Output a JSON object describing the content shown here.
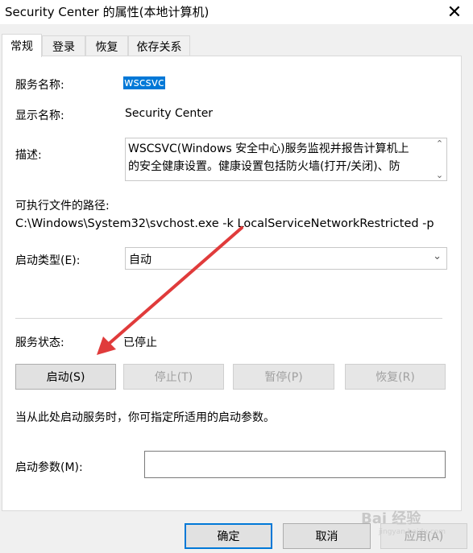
{
  "window": {
    "title": "Security Center 的属性(本地计算机)",
    "close_glyph": "✕"
  },
  "tabs": [
    {
      "label": "常规",
      "active": true
    },
    {
      "label": "登录",
      "active": false
    },
    {
      "label": "恢复",
      "active": false
    },
    {
      "label": "依存关系",
      "active": false
    }
  ],
  "general": {
    "service_name_label": "服务名称:",
    "service_name_value": "wscsvc",
    "display_name_label": "显示名称:",
    "display_name_value": "Security Center",
    "description_label": "描述:",
    "description_line1": "WSCSVC(Windows 安全中心)服务监视并报告计算机上",
    "description_line2": "的安全健康设置。健康设置包括防火墙(打开/关闭)、防",
    "exe_path_label": "可执行文件的路径:",
    "exe_path_value": "C:\\Windows\\System32\\svchost.exe -k LocalServiceNetworkRestricted -p",
    "startup_type_label": "启动类型(E):",
    "startup_type_value": "自动",
    "service_status_label": "服务状态:",
    "service_status_value": "已停止",
    "start_button": "启动(S)",
    "stop_button": "停止(T)",
    "pause_button": "暂停(P)",
    "resume_button": "恢复(R)",
    "hint_text": "当从此处启动服务时，你可指定所适用的启动参数。",
    "start_params_label": "启动参数(M):",
    "start_params_value": ""
  },
  "footer": {
    "ok_button": "确定",
    "cancel_button": "取消",
    "apply_button": "应用(A)"
  },
  "watermark": {
    "brand": "Bai 经验",
    "url": "jingyan.baidu.com"
  },
  "colors": {
    "accent": "#0078d7",
    "annotation_arrow": "#e03b3b"
  }
}
